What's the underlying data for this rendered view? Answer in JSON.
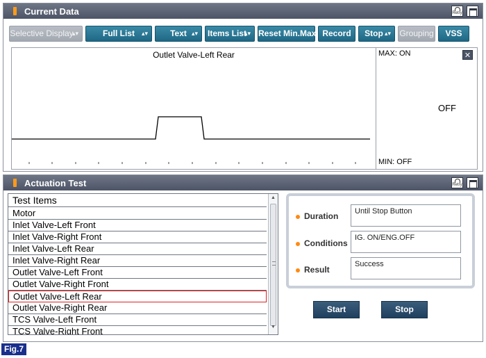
{
  "current_data": {
    "title": "Current Data",
    "retry_label": "Retry",
    "toolbar": [
      {
        "label": "Selective Display",
        "dropdown": true,
        "enabled": false
      },
      {
        "label": "Full List",
        "dropdown": true,
        "enabled": true
      },
      {
        "label": "Text",
        "dropdown": true,
        "enabled": true
      },
      {
        "label": "Items List",
        "dropdown": true,
        "enabled": true
      },
      {
        "label": "Reset Min.Max",
        "dropdown": false,
        "enabled": true
      },
      {
        "label": "Record",
        "dropdown": false,
        "enabled": true
      },
      {
        "label": "Stop",
        "dropdown": true,
        "enabled": true
      },
      {
        "label": "Grouping",
        "dropdown": false,
        "enabled": false
      },
      {
        "label": "VSS",
        "dropdown": false,
        "enabled": true
      }
    ],
    "graph": {
      "title": "Outlet Valve-Left Rear",
      "max_label": "MAX: ON",
      "min_label": "MIN: OFF",
      "current_value": "OFF",
      "close_icon": "close-icon"
    }
  },
  "actuation_test": {
    "title": "Actuation Test",
    "retry_label": "Retry",
    "list_header": "Test Items",
    "items": [
      "Motor",
      "Inlet Valve-Left Front",
      "Inlet Valve-Right Front",
      "Inlet Valve-Left Rear",
      "Inlet Valve-Right Rear",
      "Outlet Valve-Left Front",
      "Outlet Valve-Right Front",
      "Outlet Valve-Left Rear",
      "Outlet Valve-Right Rear",
      "TCS Valve-Left Front",
      "TCS Valve-Right Front"
    ],
    "selected_item": "Outlet Valve-Left Rear",
    "fields": [
      {
        "label": "Duration",
        "value": "Until Stop Button"
      },
      {
        "label": "Conditions",
        "value": "IG. ON/ENG.OFF"
      },
      {
        "label": "Result",
        "value": "Success"
      }
    ],
    "start_label": "Start",
    "stop_label": "Stop"
  },
  "figure_label": "Fig.7",
  "colors": {
    "titlebar": "#5a6173",
    "toolbar_button": "#2a7a98",
    "bullet": "#ff8a10",
    "selection_border": "#e02020",
    "figure_tag": "#1a2f8c"
  }
}
